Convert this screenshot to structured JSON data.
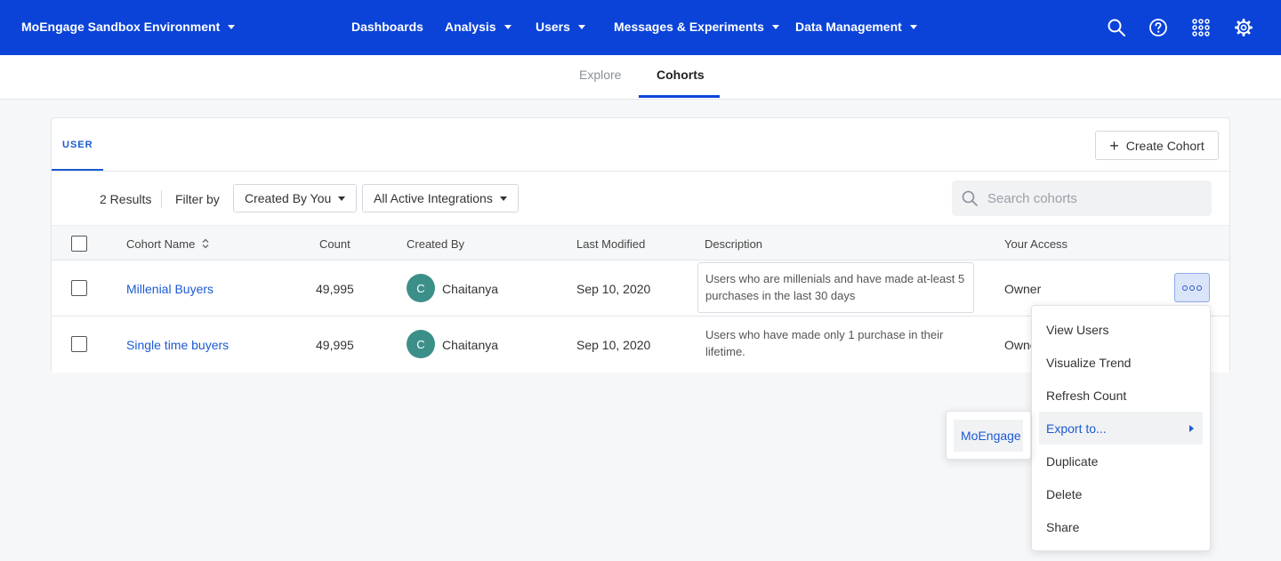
{
  "header": {
    "workspace": "MoEngage Sandbox Environment",
    "nav": {
      "dashboards": "Dashboards",
      "analysis": "Analysis",
      "users": "Users",
      "messages": "Messages & Experiments",
      "data_management": "Data Management"
    },
    "icons": [
      "search-icon",
      "help-icon",
      "apps-grid-icon",
      "settings-gear-icon"
    ],
    "bg_color": "#0b43d8"
  },
  "subnav": {
    "explore": "Explore",
    "cohorts": "Cohorts",
    "active_tab": "Cohorts"
  },
  "card": {
    "tab": "USER",
    "create_button": "Create Cohort",
    "results": "2 Results",
    "filter_label": "Filter by",
    "filter_created_by": "Created By You",
    "filter_integrations": "All Active Integrations",
    "search_placeholder": "Search cohorts"
  },
  "table": {
    "columns": {
      "name": "Cohort Name",
      "count": "Count",
      "created_by": "Created By",
      "last_modified": "Last Modified",
      "description": "Description",
      "access": "Your Access"
    },
    "rows": [
      {
        "name": "Millenial Buyers",
        "count": "49,995",
        "avatar": "C",
        "created_by": "Chaitanya",
        "last_modified": "Sep 10, 2020",
        "description": "Users who are millenials and have made at-least 5 purchases in the last 30 days",
        "access": "Owner"
      },
      {
        "name": "Single time buyers",
        "count": "49,995",
        "avatar": "C",
        "created_by": "Chaitanya",
        "last_modified": "Sep 10, 2020",
        "description": "Users who have made only 1 purchase in their lifetime.",
        "access": "Owner"
      }
    ]
  },
  "menu": {
    "items": [
      "View Users",
      "Visualize Trend",
      "Refresh Count",
      "Export to...",
      "Duplicate",
      "Delete",
      "Share"
    ],
    "active": "Export to...",
    "submenu": [
      "MoEngage"
    ]
  }
}
